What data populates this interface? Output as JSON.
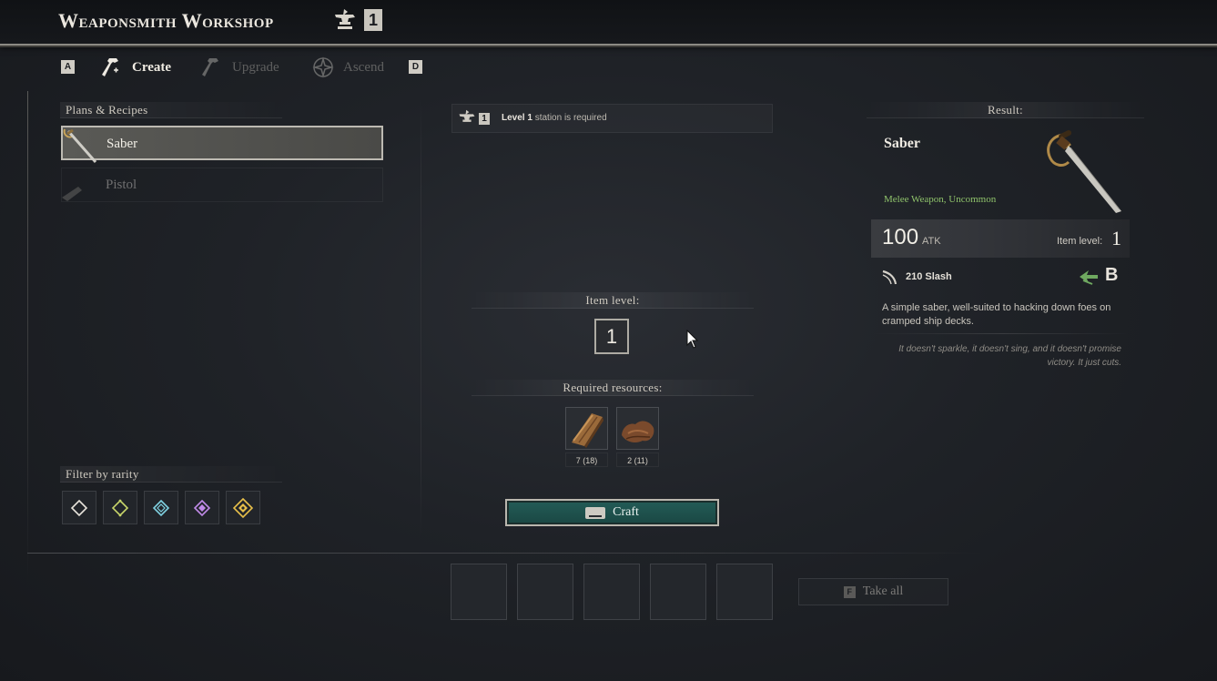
{
  "header": {
    "title": "Weaponsmith Workshop",
    "station_level": "1"
  },
  "tabs": {
    "key_left": "A",
    "key_right": "D",
    "items": [
      {
        "label": "Create",
        "icon": "hammer-icon",
        "active": true
      },
      {
        "label": "Upgrade",
        "icon": "hammer-icon",
        "active": false
      },
      {
        "label": "Ascend",
        "icon": "star-emblem-icon",
        "active": false
      }
    ]
  },
  "plans": {
    "header": "Plans & Recipes",
    "items": [
      {
        "label": "Saber",
        "icon": "saber-icon",
        "selected": true
      },
      {
        "label": "Pistol",
        "icon": "pistol-icon",
        "selected": false
      }
    ]
  },
  "filter": {
    "header": "Filter by rarity",
    "rarities": [
      {
        "name": "common",
        "color": "#e8e4dc"
      },
      {
        "name": "uncommon",
        "color": "#c8d66a"
      },
      {
        "name": "rare",
        "color": "#7fd0e0"
      },
      {
        "name": "epic",
        "color": "#c08ae8"
      },
      {
        "name": "legendary",
        "color": "#e8c04a"
      }
    ]
  },
  "crafting": {
    "station_level": "1",
    "station_level_text": "Level 1",
    "station_required_text": "station is required",
    "item_level_header": "Item level:",
    "item_level": "1",
    "resources_header": "Required resources:",
    "resources": [
      {
        "name": "wood-plank-icon",
        "count": "7 (18)"
      },
      {
        "name": "leather-hide-icon",
        "count": "2 (11)"
      }
    ],
    "craft_label": "Craft",
    "accent_color": "#235c57"
  },
  "output": {
    "slots": 5,
    "take_all_key": "F",
    "take_all_label": "Take all"
  },
  "result": {
    "header": "Result:",
    "name": "Saber",
    "type": "Melee Weapon, Uncommon",
    "type_color": "#8fc36b",
    "atk_value": "100",
    "atk_unit": "ATK",
    "item_level_label": "Item level:",
    "item_level": "1",
    "damage_text": "210 Slash",
    "scaling_grade": "B",
    "description": "A simple saber, well-suited to hacking down foes on cramped ship decks.",
    "flavor": "It doesn't sparkle, it doesn't sing, and it doesn't promise victory. It just cuts."
  }
}
